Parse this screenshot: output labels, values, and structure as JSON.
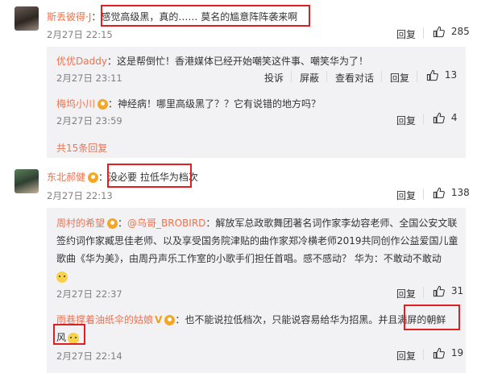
{
  "comments": [
    {
      "name": "斯丢彼得·J",
      "text": "感觉高级黑，真的…… 莫名的尴意阵阵袭来啊",
      "time": "2月27日 22:15",
      "reply_label": "回复",
      "likes": "285",
      "replies": [
        {
          "name": "优优Daddy",
          "text": "这是帮倒忙！香港媒体已经开始嘲笑这件事、嘲笑华为了！",
          "time": "2月27日 23:11",
          "actions": [
            "投诉",
            "屏蔽",
            "查看对话",
            "回复"
          ],
          "likes": "13"
        },
        {
          "name": "梅坞小川",
          "text": "神经病！哪里高级黑了？？它有说错的地方吗？",
          "time": "2月27日 23:59",
          "reply_label": "回复",
          "likes": "4"
        }
      ],
      "more_replies": "共15条回复"
    },
    {
      "name": "东北郝健",
      "text": "没必要 拉低华为档次",
      "time": "2月27日 22:13",
      "reply_label": "回复",
      "likes": "138",
      "replies": [
        {
          "name": "周村的希望",
          "mention": "@乌哥_BROBIRD",
          "text_line1": "解放军总政歌舞团著名词作家李幼容老师、全国公安文联",
          "text_line2": "签约词作家臧思佳老师、以及享受国务院津贴的曲作家郑冷横老师2019共同创作公益爱国儿童",
          "text_line3": "歌曲《华为美》，由周丹声乐工作室的小歌手们担任首唱。感不感动？ 华为：不敢动不敢动",
          "time": "2月27日 22:37",
          "reply_label": "回复",
          "likes": "31"
        },
        {
          "name": "雨巷撑着油纸伞的姑娘",
          "text_line1": "也不能说拉低档次，只能说容易给华为招黑。并且满屏的朝鲜",
          "text_line2": "风",
          "time": "2月27日 22:14",
          "reply_label": "回复",
          "likes": "19"
        }
      ]
    }
  ]
}
